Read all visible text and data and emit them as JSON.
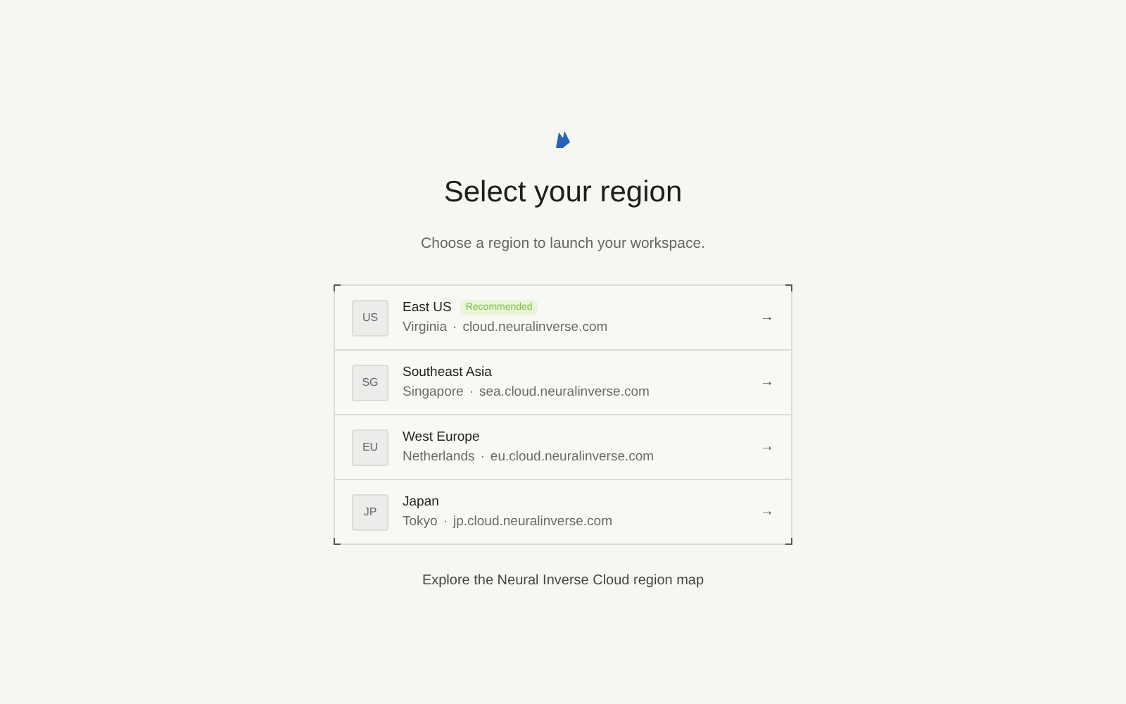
{
  "title": "Select your region",
  "subtitle": "Choose a region to launch your workspace.",
  "regions": [
    {
      "code": "US",
      "name": "East US",
      "badge": "Recommended",
      "location": "Virginia",
      "host": "cloud.neuralinverse.com",
      "arrow": "→"
    },
    {
      "code": "SG",
      "name": "Southeast Asia",
      "location": "Singapore",
      "host": "sea.cloud.neuralinverse.com",
      "arrow": "→"
    },
    {
      "code": "EU",
      "name": "West Europe",
      "location": "Netherlands",
      "host": "eu.cloud.neuralinverse.com",
      "arrow": "→"
    },
    {
      "code": "JP",
      "name": "Japan",
      "location": "Tokyo",
      "host": "jp.cloud.neuralinverse.com",
      "arrow": "→"
    }
  ],
  "separator": "·",
  "footer_link": "Explore the Neural Inverse Cloud region map"
}
